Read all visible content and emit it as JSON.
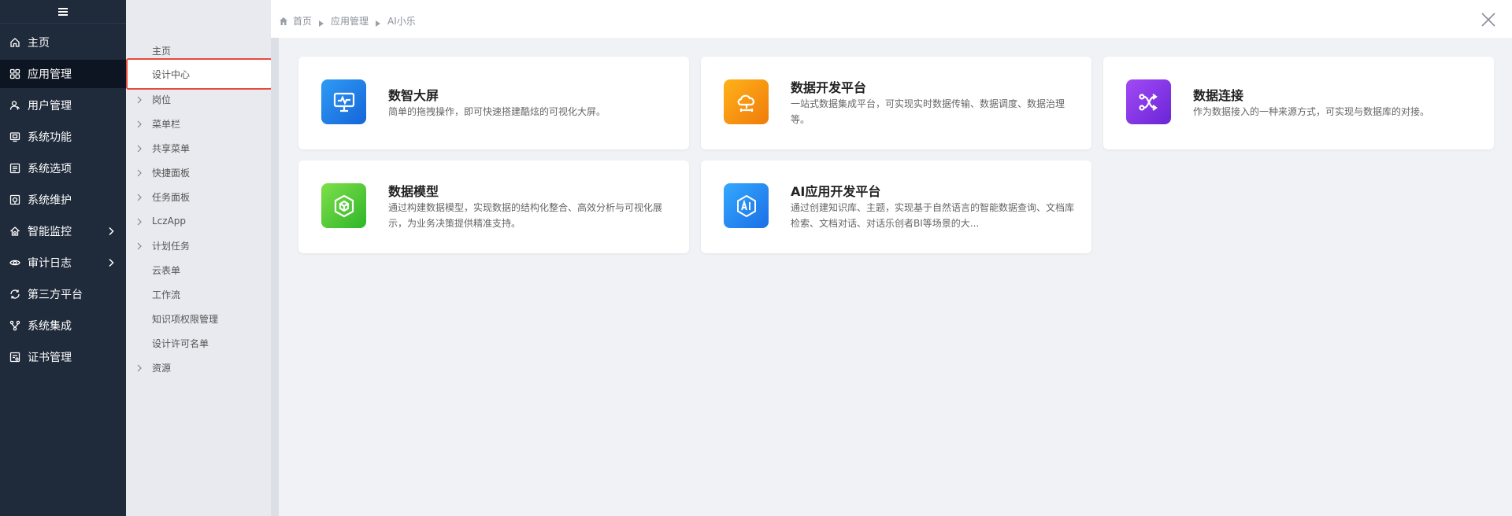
{
  "sidebar": {
    "items": [
      {
        "label": "主页",
        "icon": "home-icon",
        "active": false,
        "has_children": false
      },
      {
        "label": "应用管理",
        "icon": "grid-icon",
        "active": true,
        "has_children": false
      },
      {
        "label": "用户管理",
        "icon": "users-icon",
        "active": false,
        "has_children": false
      },
      {
        "label": "系统功能",
        "icon": "monitor-icon",
        "active": false,
        "has_children": false
      },
      {
        "label": "系统选项",
        "icon": "list-icon",
        "active": false,
        "has_children": false
      },
      {
        "label": "系统维护",
        "icon": "tools-icon",
        "active": false,
        "has_children": false
      },
      {
        "label": "智能监控",
        "icon": "shield-icon",
        "active": false,
        "has_children": true
      },
      {
        "label": "审计日志",
        "icon": "eye-icon",
        "active": false,
        "has_children": true
      },
      {
        "label": "第三方平台",
        "icon": "sync-icon",
        "active": false,
        "has_children": false
      },
      {
        "label": "系统集成",
        "icon": "share-icon",
        "active": false,
        "has_children": false
      },
      {
        "label": "证书管理",
        "icon": "certificate-icon",
        "active": false,
        "has_children": false
      }
    ]
  },
  "submenu": {
    "items": [
      {
        "label": "主页",
        "expandable": false,
        "selected": false
      },
      {
        "label": "设计中心",
        "expandable": false,
        "selected": true
      },
      {
        "label": "岗位",
        "expandable": true,
        "selected": false
      },
      {
        "label": "菜单栏",
        "expandable": true,
        "selected": false
      },
      {
        "label": "共享菜单",
        "expandable": true,
        "selected": false
      },
      {
        "label": "快捷面板",
        "expandable": true,
        "selected": false
      },
      {
        "label": "任务面板",
        "expandable": true,
        "selected": false
      },
      {
        "label": "LczApp",
        "expandable": true,
        "selected": false
      },
      {
        "label": "计划任务",
        "expandable": true,
        "selected": false
      },
      {
        "label": "云表单",
        "expandable": false,
        "selected": false
      },
      {
        "label": "工作流",
        "expandable": false,
        "selected": false
      },
      {
        "label": "知识项权限管理",
        "expandable": false,
        "selected": false
      },
      {
        "label": "设计许可名单",
        "expandable": false,
        "selected": false
      },
      {
        "label": "资源",
        "expandable": true,
        "selected": false
      }
    ]
  },
  "breadcrumb": {
    "items": [
      "首页",
      "应用管理",
      "AI小乐"
    ]
  },
  "cards": [
    {
      "title": "数智大屏",
      "desc": "简单的拖拽操作，即可快速搭建酷炫的可视化大屏。",
      "icon": "monitor-pulse-icon",
      "color_from": "#2f9bf5",
      "color_to": "#1565d8"
    },
    {
      "title": "数据开发平台",
      "desc": "一站式数据集成平台，可实现实时数据传输、数据调度、数据治理等。",
      "icon": "cloud-network-icon",
      "color_from": "#ffb21a",
      "color_to": "#f07b0a"
    },
    {
      "title": "数据连接",
      "desc": "作为数据接入的一种来源方式，可实现与数据库的对接。",
      "icon": "shuffle-icon",
      "color_from": "#a24af5",
      "color_to": "#6a25d6"
    },
    {
      "title": "数据模型",
      "desc": "通过构建数据模型，实现数据的结构化整合、高效分析与可视化展示，为业务决策提供精准支持。",
      "icon": "cube-icon",
      "color_from": "#7ee04a",
      "color_to": "#2fb52a"
    },
    {
      "title": "AI应用开发平台",
      "desc": "通过创建知识库、主题，实现基于自然语言的智能数据查询、文档库检索、文档对话、对话乐创者BI等场景的大...",
      "icon": "ai-chip-icon",
      "color_from": "#35a8ff",
      "color_to": "#1a6fe6"
    }
  ],
  "colors": {
    "sidebar_bg": "#1f2a3a",
    "sidebar_active": "#0d1522",
    "submenu_bg": "#e8eaf0",
    "highlight_border": "#e64b3b",
    "page_bg": "#f0f2f5"
  }
}
